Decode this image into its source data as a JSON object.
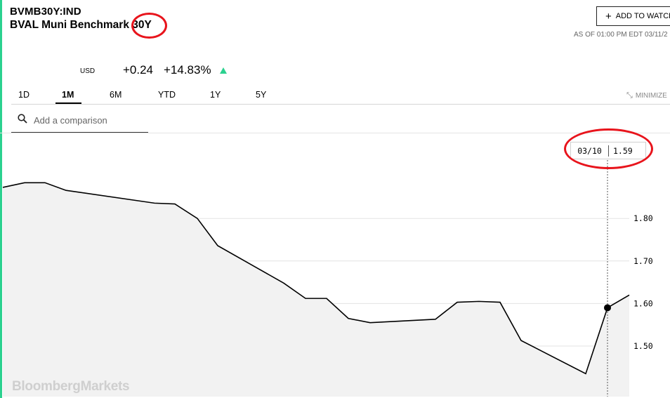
{
  "header": {
    "ticker": "BVMB30Y:IND",
    "name": "BVAL Muni Benchmark 30Y",
    "add_to_watchlist": "ADD TO WATCH",
    "as_of": "AS OF 01:00 PM EDT 03/11/2"
  },
  "quote": {
    "currency": "USD",
    "change": "+0.24",
    "change_pct": "+14.83%",
    "direction": "up",
    "up_color": "#2bd18f"
  },
  "tabs": {
    "items": [
      "1D",
      "1M",
      "6M",
      "YTD",
      "1Y",
      "5Y"
    ],
    "active": "1M",
    "minimize": "MINIMIZE"
  },
  "search": {
    "placeholder": "Add a comparison"
  },
  "tooltip": {
    "date": "03/10",
    "value": "1.59"
  },
  "watermark": "BloombergMarkets",
  "chart_data": {
    "type": "area",
    "ylim": [
      1.4,
      1.95
    ],
    "y_ticks": [
      "1.80",
      "1.70",
      "1.60",
      "1.50"
    ],
    "y_tick_values": [
      1.8,
      1.7,
      1.6,
      1.5
    ],
    "grid": true,
    "series": [
      {
        "values": [
          1.873,
          1.884,
          1.884,
          1.866,
          1.836,
          1.834,
          1.8,
          1.736,
          1.648,
          1.612,
          1.612,
          1.565,
          1.555,
          1.563,
          1.603,
          1.605,
          1.603,
          1.513,
          1.435,
          1.59,
          1.62
        ]
      }
    ],
    "highlight": {
      "index": 19,
      "label": "03/10",
      "value": 1.59
    }
  }
}
